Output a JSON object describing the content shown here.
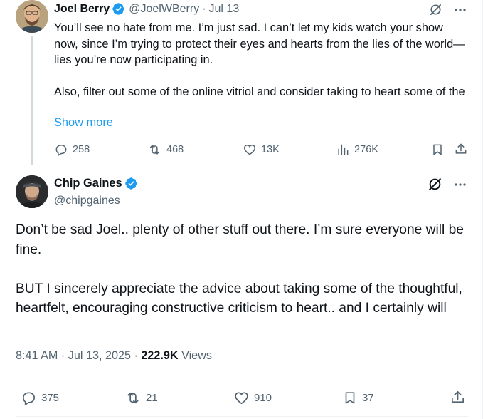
{
  "reply": {
    "display_name": "Joel Berry",
    "handle": "@JoelWBerry",
    "separator": "·",
    "date": "Jul 13",
    "text_paragraphs": [
      "You’ll see no hate from me. I’m just sad. I can’t let my kids watch your show now, since I’m trying to protect their eyes and hearts from the lies of the world—lies you’re now participating in.",
      "Also, filter out some of the online vitriol and consider taking to heart some of the"
    ],
    "show_more": "Show more",
    "stats": {
      "replies": "258",
      "reposts": "468",
      "likes": "13K",
      "views": "276K"
    }
  },
  "main": {
    "display_name": "Chip Gaines",
    "handle": "@chipgaines",
    "text_paragraphs": [
      "Don’t be sad Joel.. plenty of other stuff out there. I’m sure everyone will be fine.",
      "BUT I sincerely appreciate the advice about taking some of the thoughtful, heartfelt, encouraging constructive criticism to heart.. and I certainly will"
    ],
    "timestamp": "8:41 AM · Jul 13, 2025 · ",
    "views_count": "222.9K",
    "views_label": " Views",
    "stats": {
      "replies": "375",
      "reposts": "21",
      "likes": "910",
      "bookmarks": "37"
    }
  },
  "colors": {
    "text": "#0f1419",
    "secondary": "#536471",
    "link": "#1d9bf0",
    "verified": "#1d9bf0",
    "divider": "#eff3f4"
  },
  "icons": [
    "verified-badge-icon",
    "grok-icon",
    "more-icon",
    "reply-icon",
    "repost-icon",
    "like-icon",
    "views-icon",
    "bookmark-icon",
    "share-icon"
  ]
}
